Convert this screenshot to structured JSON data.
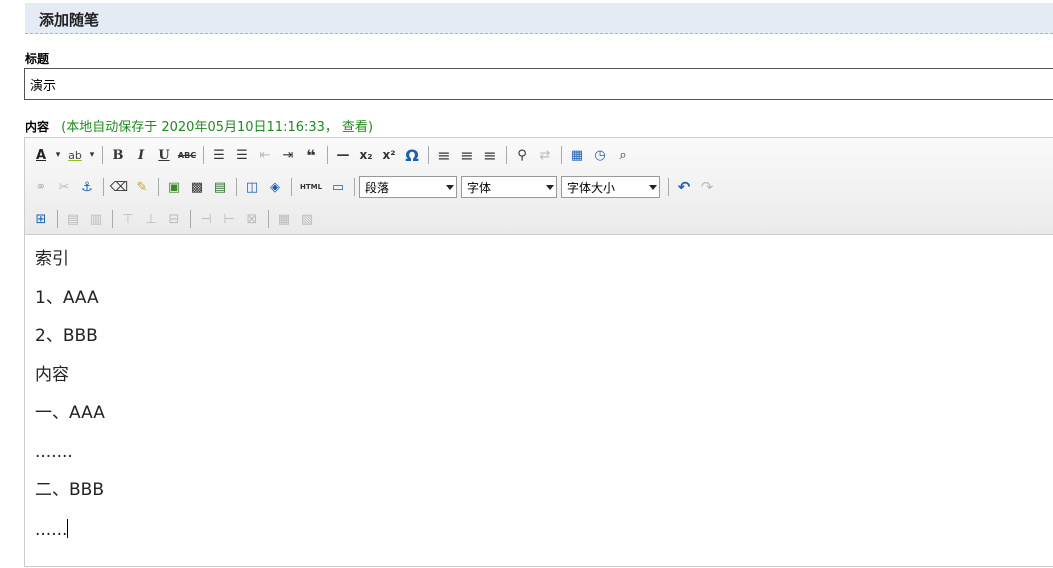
{
  "header": {
    "title": "添加随笔"
  },
  "form": {
    "title_label": "标题",
    "title_value": "演示",
    "content_label": "内容",
    "autosave_text": "(本地自动保存于 2020年05月10日11:16:33，",
    "autosave_link": "查看",
    "autosave_close": ")"
  },
  "toolbar": {
    "row1": [
      {
        "name": "text-color-icon",
        "glyph": "A"
      },
      {
        "name": "highlight-color-icon",
        "glyph": "ab"
      },
      {
        "name": "bold-icon",
        "glyph": "B"
      },
      {
        "name": "italic-icon",
        "glyph": "I"
      },
      {
        "name": "underline-icon",
        "glyph": "U"
      },
      {
        "name": "strikethrough-icon",
        "glyph": "ABC"
      },
      {
        "name": "bullet-list-icon",
        "glyph": "☰"
      },
      {
        "name": "numbered-list-icon",
        "glyph": "☰"
      },
      {
        "name": "outdent-icon",
        "glyph": "⇤"
      },
      {
        "name": "indent-icon",
        "glyph": "⇥"
      },
      {
        "name": "blockquote-icon",
        "glyph": "❝"
      },
      {
        "name": "horizontal-rule-icon",
        "glyph": "—"
      },
      {
        "name": "subscript-icon",
        "glyph": "x₂"
      },
      {
        "name": "superscript-icon",
        "glyph": "x²"
      },
      {
        "name": "special-char-icon",
        "glyph": "Ω"
      },
      {
        "name": "align-left-icon",
        "glyph": "≡"
      },
      {
        "name": "align-center-icon",
        "glyph": "≡"
      },
      {
        "name": "align-right-icon",
        "glyph": "≡"
      },
      {
        "name": "find-icon",
        "glyph": "⚲"
      },
      {
        "name": "replace-icon",
        "glyph": "⇄"
      },
      {
        "name": "insert-date-icon",
        "glyph": "▦"
      },
      {
        "name": "insert-time-icon",
        "glyph": "◷"
      },
      {
        "name": "preview-icon",
        "glyph": "⌕"
      }
    ],
    "paragraph_select": "段落",
    "font_select": "字体",
    "font_size_select": "字体大小"
  },
  "content": {
    "lines": [
      "索引",
      "1、AAA",
      "2、BBB",
      "内容",
      "一、AAA",
      ".......",
      "二、BBB",
      "......"
    ]
  }
}
